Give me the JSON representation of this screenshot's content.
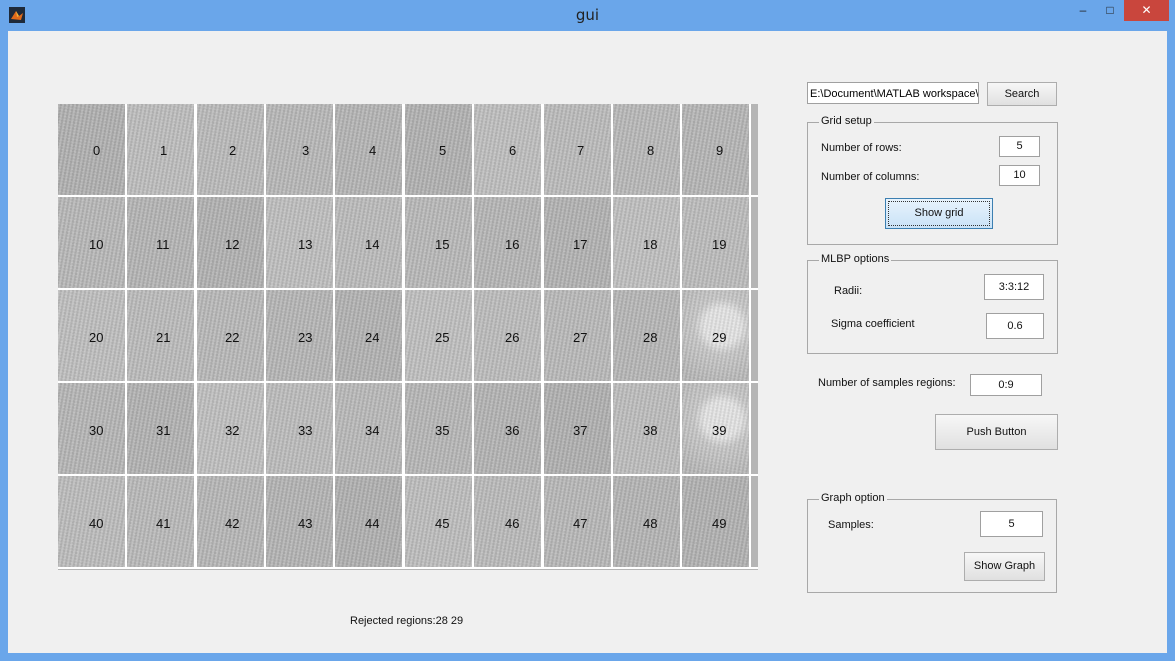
{
  "window": {
    "title": "gui",
    "minimize": "–",
    "maximize": "□",
    "close": "✕"
  },
  "grid": {
    "rows": 5,
    "columns": 10,
    "cells": [
      "0",
      "1",
      "2",
      "3",
      "4",
      "5",
      "6",
      "7",
      "8",
      "9",
      "10",
      "11",
      "12",
      "13",
      "14",
      "15",
      "16",
      "17",
      "18",
      "19",
      "20",
      "21",
      "22",
      "23",
      "24",
      "25",
      "26",
      "27",
      "28",
      "29",
      "30",
      "31",
      "32",
      "33",
      "34",
      "35",
      "36",
      "37",
      "38",
      "39",
      "40",
      "41",
      "42",
      "43",
      "44",
      "45",
      "46",
      "47",
      "48",
      "49"
    ]
  },
  "status": {
    "rejected": "Rejected regions:28  29"
  },
  "path": {
    "value": "E:\\Document\\MATLAB workspace\\",
    "search_label": "Search"
  },
  "grid_setup": {
    "title": "Grid setup",
    "rows_label": "Number of rows:",
    "rows_value": "5",
    "cols_label": "Number of columns:",
    "cols_value": "10",
    "show_grid_label": "Show grid"
  },
  "mlbp": {
    "title": "MLBP options",
    "radii_label": "Radii:",
    "radii_value": "3:3:12",
    "sigma_label": "Sigma coefficient",
    "sigma_value": "0.6"
  },
  "samples_regions": {
    "label": "Number of samples regions:",
    "value": "0:9"
  },
  "push_button": {
    "label": "Push Button"
  },
  "graph": {
    "title": "Graph option",
    "samples_label": "Samples:",
    "samples_value": "5",
    "show_graph_label": "Show Graph"
  }
}
